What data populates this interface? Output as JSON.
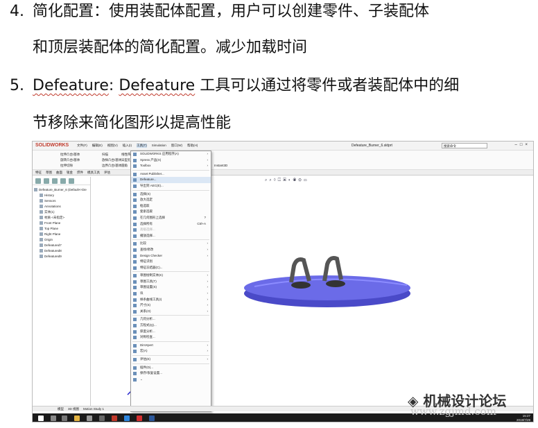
{
  "item4": {
    "number": "4.",
    "line1": "简化配置：使用装配体配置，用户可以创建零件、子装配体",
    "line2": "和顶层装配体的简化配置。减少加载时间"
  },
  "item5": {
    "number": "5.",
    "term": "Defeature",
    "colon": ": ",
    "line1_rest": " 工具可以通过将零件或者装配体中的细",
    "line2": "节移除来简化图形以提高性能"
  },
  "screenshot": {
    "logo": "SOLIDWORKS",
    "menu": [
      "文件(F)",
      "编辑(E)",
      "视图(V)",
      "插入(I)",
      "工具(T)",
      "Simulation",
      "窗口(W)",
      "帮助(H)"
    ],
    "document_title": "Defeature_Burner_6.sldprt",
    "search_placeholder": "搜索命令",
    "ribbon": {
      "a": "拉伸凸台/基体",
      "b": "旋转凸台/基体",
      "c": "扫描",
      "d": "放样凸台/基体",
      "e": "边界凸台/基体",
      "f": "拉伸切除",
      "g": "异型孔",
      "h": "圆角",
      "i": "线性阵列",
      "instant3d": "Instant3D"
    },
    "tabs": [
      "特征",
      "草图",
      "曲面",
      "钣金",
      "焊件",
      "模具工具",
      "评估",
      "分析准备"
    ],
    "tree": {
      "root": "Defeature_Burner_6 (Default<<De",
      "items": [
        "History",
        "Sensors",
        "Annotations",
        "实体(1)",
        "材质 <未指定>",
        "Front Plane",
        "Top Plane",
        "Right Plane",
        "Origin",
        "Defeatured7",
        "Defeatured8",
        "Defeatured9"
      ]
    },
    "dropdown": {
      "items": [
        {
          "label": "SOLIDWORKS 应用程序(A)",
          "arrow": "›"
        },
        {
          "label": "Xpress 产品(X)",
          "arrow": "›"
        },
        {
          "label": "Toolbox",
          "arrow": "›"
        },
        {
          "label": "Asset Publisher..."
        },
        {
          "label": "Defeature...",
          "hl": true
        },
        {
          "label": "导出到 AEC(E)..."
        },
        {
          "label": "选择(S)"
        },
        {
          "label": "放大选定"
        },
        {
          "label": "框选取"
        },
        {
          "label": "套索选取"
        },
        {
          "label": "在几何图形上选择",
          "key": "?"
        },
        {
          "label": "选择所有",
          "key": "Ctrl+A"
        },
        {
          "label": "高级选择...",
          "dim": true
        },
        {
          "label": "播放选择..."
        },
        {
          "label": "比较",
          "arrow": "›"
        },
        {
          "label": "查找/修改",
          "arrow": "›"
        },
        {
          "label": "Design Checker",
          "arrow": "›"
        },
        {
          "label": "特征识别"
        },
        {
          "label": "特征冻结器(C)..."
        },
        {
          "label": "草图绘制实体(K)",
          "arrow": "›"
        },
        {
          "label": "草图工具(T)",
          "arrow": "›"
        },
        {
          "label": "草图设置(S)",
          "arrow": "›"
        },
        {
          "label": "块",
          "arrow": "›"
        },
        {
          "label": "样条曲线工具(I)",
          "arrow": "›"
        },
        {
          "label": "尺寸(S)",
          "arrow": "›"
        },
        {
          "label": "关系(O)",
          "arrow": "›"
        },
        {
          "label": "几何分析..."
        },
        {
          "label": "方程式(Q)..."
        },
        {
          "label": "厚度分析..."
        },
        {
          "label": "对称检查..."
        },
        {
          "label": "DimXpert",
          "arrow": "›"
        },
        {
          "label": "宏(A)",
          "arrow": "›"
        },
        {
          "label": "评估(E)",
          "arrow": "›"
        },
        {
          "label": "插件(D)..."
        },
        {
          "label": "保存/恢复设置..."
        },
        {
          "label": "⌄"
        }
      ]
    },
    "bottom_tabs": [
      "模型",
      "3D 视图",
      "Motion Study 1"
    ],
    "clock_time": "15:27",
    "clock_date": "2019/7/29"
  },
  "watermark": {
    "text": "机械设计论坛",
    "url": "www.zgjmd.com"
  }
}
